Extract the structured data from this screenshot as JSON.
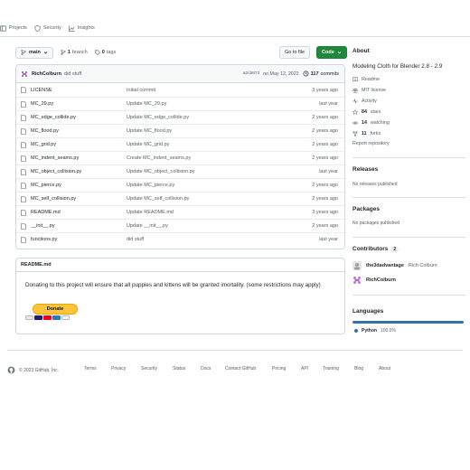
{
  "nav": {
    "projects": "Projects",
    "security": "Security",
    "insights": "Insights"
  },
  "branch": {
    "name": "main",
    "branches_count": "1",
    "branches_label": "branch",
    "tags_count": "0",
    "tags_label": "tags",
    "goto_label": "Go to file",
    "code_label": "Code"
  },
  "commit": {
    "author": "RichColburn",
    "message": "did stuff",
    "hash": "a2cb873",
    "date": "on May 12, 2022",
    "count": "117",
    "count_label": "commits"
  },
  "files": [
    {
      "name": "LICENSE",
      "message": "Initial commit",
      "age": "3 years ago"
    },
    {
      "name": "MC_29.py",
      "message": "Update MC_29.py",
      "age": "last year"
    },
    {
      "name": "MC_edge_collide.py",
      "message": "Update MC_edge_collide.py",
      "age": "2 years ago"
    },
    {
      "name": "MC_flood.py",
      "message": "Update MC_flood.py",
      "age": "2 years ago"
    },
    {
      "name": "MC_grid.py",
      "message": "Update MC_grid.py",
      "age": "2 years ago"
    },
    {
      "name": "MC_indent_seams.py",
      "message": "Create MC_indent_seams.py",
      "age": "2 years ago"
    },
    {
      "name": "MC_object_collision.py",
      "message": "Update MC_object_collision.py",
      "age": "last year"
    },
    {
      "name": "MC_pierce.py",
      "message": "Update MC_pierce.py",
      "age": "2 years ago"
    },
    {
      "name": "MC_self_collision.py",
      "message": "Update MC_self_collision.py",
      "age": "2 years ago"
    },
    {
      "name": "README.md",
      "message": "Update README.md",
      "age": "3 years ago"
    },
    {
      "name": "__init__.py",
      "message": "Update __init__.py",
      "age": "2 years ago"
    },
    {
      "name": "functions.py",
      "message": "did stuff",
      "age": "last year"
    }
  ],
  "readme": {
    "title": "README.md",
    "text": "Donating to this project will ensure that all puppies and kittens will be granted imortality. (some restrictions may apply)",
    "donate_label": "Donate"
  },
  "about": {
    "title": "About",
    "description": "Modeling Cloth for Blender 2.8 - 2.9",
    "readme": "Readme",
    "license": "MIT license",
    "activity": "Activity",
    "stars_count": "84",
    "stars_label": "stars",
    "watching_count": "14",
    "watching_label": "watching",
    "forks_count": "11",
    "forks_label": "forks",
    "report": "Report repository"
  },
  "releases": {
    "title": "Releases",
    "empty": "No releases published"
  },
  "packages": {
    "title": "Packages",
    "empty": "No packages published"
  },
  "contributors": {
    "title": "Contributors",
    "count": "2",
    "list": [
      {
        "login": "the3dadvantage",
        "name": "Rich Colburn"
      },
      {
        "login": "RichColburn",
        "name": ""
      }
    ]
  },
  "languages": {
    "title": "Languages",
    "items": [
      {
        "name": "Python",
        "percent": "100.0%",
        "color": "#3572A5"
      }
    ]
  },
  "footer": {
    "copyright": "© 2023 GitHub, Inc.",
    "links": [
      "Terms",
      "Privacy",
      "Security",
      "Status",
      "Docs",
      "Contact GitHub",
      "Pricing",
      "API",
      "Training",
      "Blog",
      "About"
    ]
  }
}
